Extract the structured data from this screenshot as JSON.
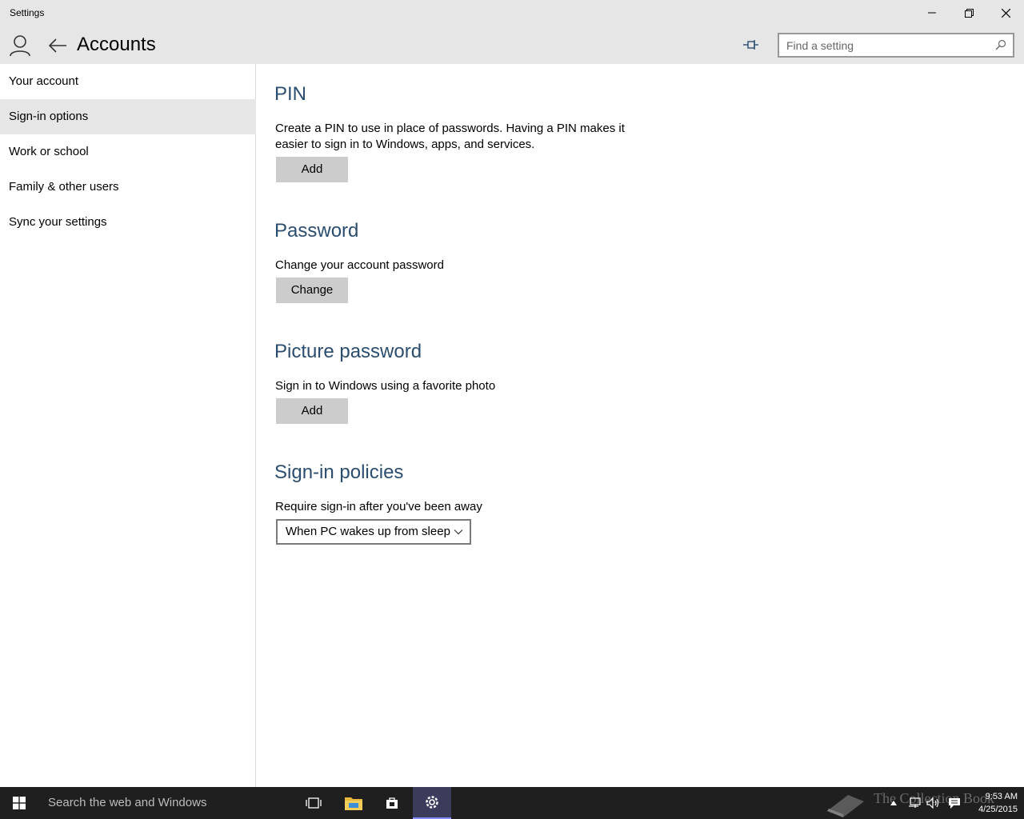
{
  "window": {
    "title": "Settings"
  },
  "header": {
    "title": "Accounts",
    "search_placeholder": "Find a setting"
  },
  "sidebar": {
    "items": [
      {
        "label": "Your account"
      },
      {
        "label": "Sign-in options",
        "selected": true
      },
      {
        "label": "Work or school"
      },
      {
        "label": "Family & other users"
      },
      {
        "label": "Sync your settings"
      }
    ]
  },
  "pin": {
    "title": "PIN",
    "description": "Create a PIN to use in place of passwords. Having a PIN makes it easier to sign in to Windows, apps, and services.",
    "button": "Add"
  },
  "password": {
    "title": "Password",
    "description": "Change your account password",
    "button": "Change"
  },
  "picture_password": {
    "title": "Picture password",
    "description": "Sign in to Windows using a favorite photo",
    "button": "Add"
  },
  "signin_policies": {
    "title": "Sign-in policies",
    "description": "Require sign-in after you've been away",
    "selected_option": "When PC wakes up from sleep"
  },
  "taskbar": {
    "search_text": "Search the web and Windows",
    "watermark": "The Collection Book",
    "time": "9:53 AM",
    "date": "4/25/2015"
  },
  "colors": {
    "accent_heading": "#2b4d6f",
    "title_bar": "#e6e6e6",
    "button": "#cccccc",
    "taskbar": "#1f1f1f"
  }
}
